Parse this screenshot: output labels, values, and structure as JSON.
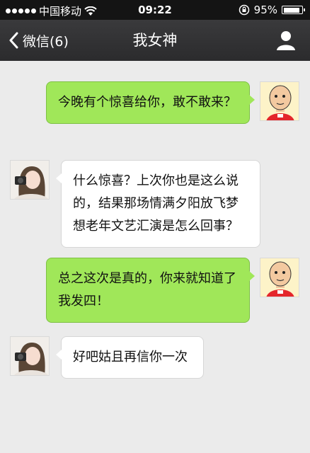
{
  "status_bar": {
    "carrier": "中国移动",
    "time": "09:22",
    "battery": "95%",
    "battery_level": 0.95
  },
  "nav": {
    "back_label": "微信(6)",
    "title": "我女神"
  },
  "messages": [
    {
      "sender": "me",
      "text": "今晚有个惊喜给你，敢不敢来？"
    },
    {
      "sender": "other",
      "text": "什么惊喜？上次你也是这么说的，结果那场情满夕阳放飞梦想老年文艺汇演是怎么回事？"
    },
    {
      "sender": "me",
      "text": "总之这次是真的，你来就知道了我发四！"
    },
    {
      "sender": "other",
      "text": "好吧姑且再信你一次"
    }
  ],
  "colors": {
    "my_bubble": "#a0e759",
    "their_bubble": "#ffffff",
    "background": "#ebebeb",
    "nav": "#2f2f31"
  }
}
